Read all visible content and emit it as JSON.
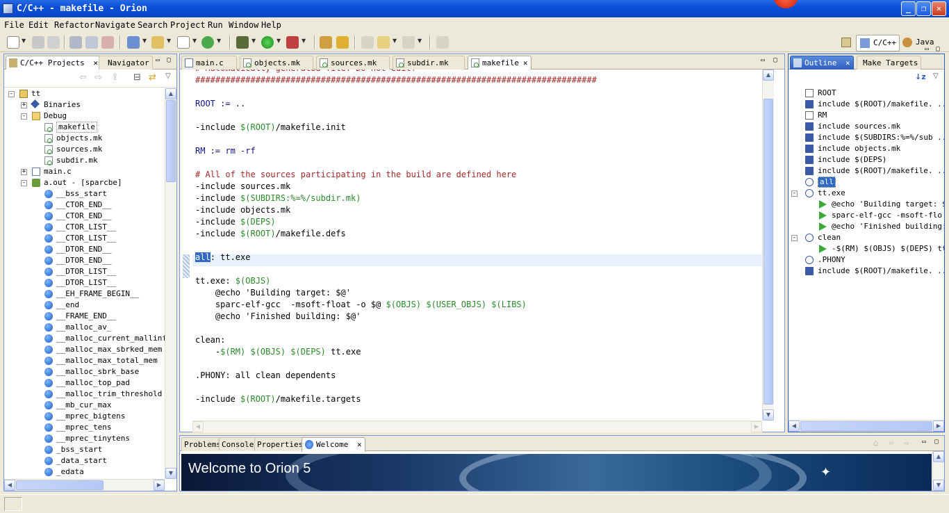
{
  "window": {
    "title": "C/C++ - makefile - Orion",
    "minimize": "_",
    "maximize": "❐",
    "close": "✕"
  },
  "menu": [
    "File",
    "Edit",
    "Refactor",
    "Navigate",
    "Search",
    "Project",
    "Run",
    "Window",
    "Help"
  ],
  "perspectives": {
    "cpp": "C/C++",
    "java": "Java"
  },
  "left_panel": {
    "tabs": [
      "C/C++ Projects",
      "Navigator"
    ],
    "tree": [
      {
        "label": "tt",
        "depth": 0,
        "exp": "-",
        "icon": "project-folder-icon"
      },
      {
        "label": "Binaries",
        "depth": 1,
        "exp": "+",
        "icon": "binaries-icon"
      },
      {
        "label": "Debug",
        "depth": 1,
        "exp": "-",
        "icon": "folder-icon"
      },
      {
        "label": "makefile",
        "depth": 2,
        "exp": "",
        "icon": "makefile-icon"
      },
      {
        "label": "objects.mk",
        "depth": 2,
        "exp": "",
        "icon": "makefile-icon"
      },
      {
        "label": "sources.mk",
        "depth": 2,
        "exp": "",
        "icon": "makefile-icon"
      },
      {
        "label": "subdir.mk",
        "depth": 2,
        "exp": "",
        "icon": "makefile-icon"
      },
      {
        "label": "main.c",
        "depth": 1,
        "exp": "+",
        "icon": "c-file-icon"
      },
      {
        "label": "a.out - [sparcbe]",
        "depth": 1,
        "exp": "-",
        "icon": "executable-icon"
      },
      {
        "label": "__bss_start",
        "depth": 2,
        "exp": "",
        "icon": "symbol-icon"
      },
      {
        "label": "__CTOR_END__",
        "depth": 2,
        "exp": "",
        "icon": "symbol-icon"
      },
      {
        "label": "__CTOR_END__",
        "depth": 2,
        "exp": "",
        "icon": "symbol-icon"
      },
      {
        "label": "__CTOR_LIST__",
        "depth": 2,
        "exp": "",
        "icon": "symbol-icon"
      },
      {
        "label": "__CTOR_LIST__",
        "depth": 2,
        "exp": "",
        "icon": "symbol-icon"
      },
      {
        "label": "__DTOR_END__",
        "depth": 2,
        "exp": "",
        "icon": "symbol-icon"
      },
      {
        "label": "__DTOR_END__",
        "depth": 2,
        "exp": "",
        "icon": "symbol-icon"
      },
      {
        "label": "__DTOR_LIST__",
        "depth": 2,
        "exp": "",
        "icon": "symbol-icon"
      },
      {
        "label": "__DTOR_LIST__",
        "depth": 2,
        "exp": "",
        "icon": "symbol-icon"
      },
      {
        "label": "__EH_FRAME_BEGIN__",
        "depth": 2,
        "exp": "",
        "icon": "symbol-icon"
      },
      {
        "label": "__end",
        "depth": 2,
        "exp": "",
        "icon": "symbol-icon"
      },
      {
        "label": "__FRAME_END__",
        "depth": 2,
        "exp": "",
        "icon": "symbol-icon"
      },
      {
        "label": "__malloc_av_",
        "depth": 2,
        "exp": "",
        "icon": "symbol-icon"
      },
      {
        "label": "__malloc_current_mallinfo",
        "depth": 2,
        "exp": "",
        "icon": "symbol-icon"
      },
      {
        "label": "__malloc_max_sbrked_mem",
        "depth": 2,
        "exp": "",
        "icon": "symbol-icon"
      },
      {
        "label": "__malloc_max_total_mem",
        "depth": 2,
        "exp": "",
        "icon": "symbol-icon"
      },
      {
        "label": "__malloc_sbrk_base",
        "depth": 2,
        "exp": "",
        "icon": "symbol-icon"
      },
      {
        "label": "__malloc_top_pad",
        "depth": 2,
        "exp": "",
        "icon": "symbol-icon"
      },
      {
        "label": "__malloc_trim_threshold",
        "depth": 2,
        "exp": "",
        "icon": "symbol-icon"
      },
      {
        "label": "__mb_cur_max",
        "depth": 2,
        "exp": "",
        "icon": "symbol-icon"
      },
      {
        "label": "__mprec_bigtens",
        "depth": 2,
        "exp": "",
        "icon": "symbol-icon"
      },
      {
        "label": "__mprec_tens",
        "depth": 2,
        "exp": "",
        "icon": "symbol-icon"
      },
      {
        "label": "__mprec_tinytens",
        "depth": 2,
        "exp": "",
        "icon": "symbol-icon"
      },
      {
        "label": "_bss_start",
        "depth": 2,
        "exp": "",
        "icon": "symbol-icon"
      },
      {
        "label": "_data_start",
        "depth": 2,
        "exp": "",
        "icon": "symbol-icon"
      },
      {
        "label": "_edata",
        "depth": 2,
        "exp": "",
        "icon": "symbol-icon"
      }
    ]
  },
  "editor": {
    "tabs": [
      {
        "label": "main.c",
        "icon": "c-file-icon"
      },
      {
        "label": "objects.mk",
        "icon": "makefile-icon"
      },
      {
        "label": "sources.mk",
        "icon": "makefile-icon"
      },
      {
        "label": "subdir.mk",
        "icon": "makefile-icon"
      },
      {
        "label": "makefile",
        "icon": "makefile-icon"
      }
    ],
    "active_tab": 4,
    "lines": [
      [
        [
          "cmt",
          "# Automatically-generated file. Do not edit!"
        ]
      ],
      [
        [
          "cmt",
          "################################################################################"
        ]
      ],
      [],
      [
        [
          "tok",
          "ROOT := .."
        ]
      ],
      [],
      [
        [
          "kw",
          "-include "
        ],
        [
          "var",
          "$(ROOT)"
        ],
        [
          "kw",
          "/makefile.init"
        ]
      ],
      [],
      [
        [
          "tok",
          "RM := rm -rf"
        ]
      ],
      [],
      [
        [
          "cmt",
          "# All of the sources participating in the build are defined here"
        ]
      ],
      [
        [
          "kw",
          "-include sources.mk"
        ]
      ],
      [
        [
          "kw",
          "-include "
        ],
        [
          "var",
          "$(SUBDIRS:%=%/subdir.mk)"
        ]
      ],
      [
        [
          "kw",
          "-include objects.mk"
        ]
      ],
      [
        [
          "kw",
          "-include "
        ],
        [
          "var",
          "$(DEPS)"
        ]
      ],
      [
        [
          "kw",
          "-include "
        ],
        [
          "var",
          "$(ROOT)"
        ],
        [
          "kw",
          "/makefile.defs"
        ]
      ],
      [],
      [
        [
          "sel",
          "all"
        ],
        [
          "kw",
          ": tt.exe"
        ]
      ],
      [],
      [
        [
          "kw",
          "tt.exe: "
        ],
        [
          "var",
          "$(OBJS)"
        ]
      ],
      [
        [
          "kw",
          "    @echo 'Building target: $@'"
        ]
      ],
      [
        [
          "kw",
          "    sparc-elf-gcc  -msoft-float -o $@ "
        ],
        [
          "var",
          "$(OBJS)"
        ],
        [
          "kw",
          " "
        ],
        [
          "var",
          "$(USER_OBJS)"
        ],
        [
          "kw",
          " "
        ],
        [
          "var",
          "$(LIBS)"
        ]
      ],
      [
        [
          "kw",
          "    @echo 'Finished building: $@'"
        ]
      ],
      [],
      [
        [
          "kw",
          "clean:"
        ]
      ],
      [
        [
          "kw",
          "    -"
        ],
        [
          "var",
          "$(RM)"
        ],
        [
          "kw",
          " "
        ],
        [
          "var",
          "$(OBJS)"
        ],
        [
          "kw",
          " "
        ],
        [
          "var",
          "$(DEPS)"
        ],
        [
          "kw",
          " tt.exe"
        ]
      ],
      [],
      [
        [
          "kw",
          ".PHONY: all clean dependents"
        ]
      ],
      [],
      [
        [
          "kw",
          "-include "
        ],
        [
          "var",
          "$(ROOT)"
        ],
        [
          "kw",
          "/makefile.targets"
        ]
      ]
    ]
  },
  "outline": {
    "tabs": [
      "Outline",
      "Make Targets"
    ],
    "items": [
      {
        "label": "ROOT",
        "depth": 0,
        "exp": "",
        "icon": "macro-icon"
      },
      {
        "label": "include $(ROOT)/makefile. ...",
        "depth": 0,
        "exp": "",
        "icon": "include-icon"
      },
      {
        "label": "RM",
        "depth": 0,
        "exp": "",
        "icon": "macro-icon"
      },
      {
        "label": "include sources.mk",
        "depth": 0,
        "exp": "",
        "icon": "include-icon"
      },
      {
        "label": "include $(SUBDIRS:%=%/sub ...",
        "depth": 0,
        "exp": "",
        "icon": "include-icon"
      },
      {
        "label": "include objects.mk",
        "depth": 0,
        "exp": "",
        "icon": "include-icon"
      },
      {
        "label": "include $(DEPS)",
        "depth": 0,
        "exp": "",
        "icon": "include-icon"
      },
      {
        "label": "include $(ROOT)/makefile. ...",
        "depth": 0,
        "exp": "",
        "icon": "include-icon"
      },
      {
        "label": "all",
        "depth": 0,
        "exp": "",
        "icon": "target-icon",
        "selected": true
      },
      {
        "label": "tt.exe",
        "depth": 0,
        "exp": "-",
        "icon": "target-icon"
      },
      {
        "label": "@echo 'Building target: $ ...",
        "depth": 1,
        "exp": "",
        "icon": "command-icon"
      },
      {
        "label": "sparc-elf-gcc  -msoft-flo ...",
        "depth": 1,
        "exp": "",
        "icon": "command-icon"
      },
      {
        "label": "@echo 'Finished building: ...",
        "depth": 1,
        "exp": "",
        "icon": "command-icon"
      },
      {
        "label": "clean",
        "depth": 0,
        "exp": "-",
        "icon": "target-icon"
      },
      {
        "label": "-$(RM) $(OBJS) $(DEPS) tt ...",
        "depth": 1,
        "exp": "",
        "icon": "command-icon"
      },
      {
        "label": ".PHONY",
        "depth": 0,
        "exp": "",
        "icon": "phony-target-icon"
      },
      {
        "label": "include $(ROOT)/makefile. ...",
        "depth": 0,
        "exp": "",
        "icon": "include-icon"
      }
    ]
  },
  "bottom_panel": {
    "tabs": [
      "Problems",
      "Console",
      "Properties",
      "Welcome"
    ],
    "welcome_title": "Welcome to Orion 5"
  },
  "colors": {
    "accent": "#316ac5",
    "comment": "#a52a2a",
    "variable": "#2a8a2a",
    "current_line": "#e8f2fe"
  }
}
